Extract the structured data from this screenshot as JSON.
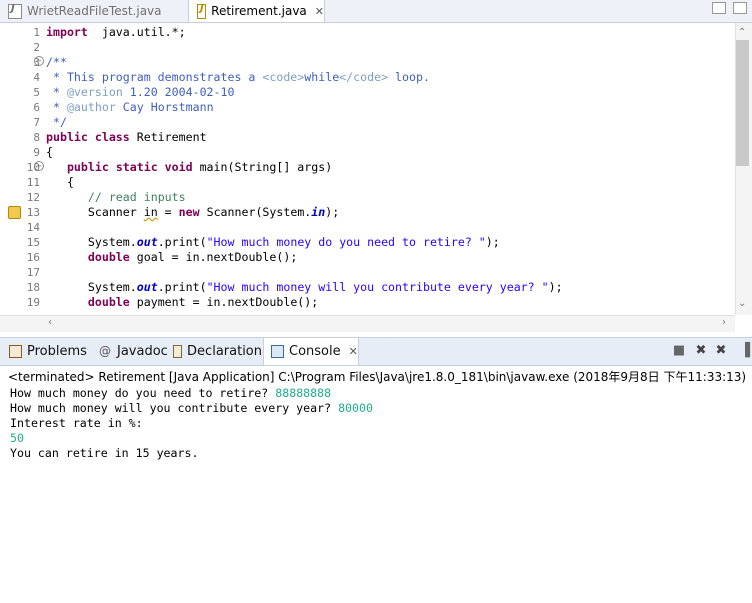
{
  "editor_tabs": [
    {
      "label": "WrietReadFileTest.java",
      "active": false
    },
    {
      "label": "Retirement.java",
      "active": true
    }
  ],
  "editor": {
    "line_numbers": [
      "1",
      "2",
      "3",
      "4",
      "5",
      "6",
      "7",
      "8",
      "9",
      "10",
      "11",
      "12",
      "13",
      "14",
      "15",
      "16",
      "17",
      "18",
      "19"
    ],
    "lines": [
      {
        "n": 1,
        "parts": [
          [
            "kw",
            "import"
          ],
          [
            "",
            "  java.util.*;"
          ]
        ]
      },
      {
        "n": 2,
        "parts": []
      },
      {
        "n": 3,
        "parts": [
          [
            "doc",
            "/**"
          ]
        ]
      },
      {
        "n": 4,
        "parts": [
          [
            "doc",
            " * This program demonstrates a "
          ],
          [
            "tag",
            "<code>"
          ],
          [
            "doc",
            "while"
          ],
          [
            "tag",
            "</code>"
          ],
          [
            "doc",
            " loop."
          ]
        ]
      },
      {
        "n": 5,
        "parts": [
          [
            "doc",
            " * "
          ],
          [
            "tag",
            "@version"
          ],
          [
            "doc",
            " 1.20 2004-02-10"
          ]
        ]
      },
      {
        "n": 6,
        "parts": [
          [
            "doc",
            " * "
          ],
          [
            "tag",
            "@author"
          ],
          [
            "doc",
            " Cay Horstmann"
          ]
        ]
      },
      {
        "n": 7,
        "parts": [
          [
            "doc",
            " */"
          ]
        ]
      },
      {
        "n": 8,
        "parts": [
          [
            "kw",
            "public class"
          ],
          [
            "",
            " Retirement"
          ]
        ]
      },
      {
        "n": 9,
        "parts": [
          [
            "",
            "{"
          ]
        ]
      },
      {
        "n": 10,
        "parts": [
          [
            "",
            "   "
          ],
          [
            "kw",
            "public static void"
          ],
          [
            "",
            " main(String[] args)"
          ]
        ]
      },
      {
        "n": 11,
        "parts": [
          [
            "",
            "   {"
          ]
        ]
      },
      {
        "n": 12,
        "parts": [
          [
            "",
            "      "
          ],
          [
            "cmt",
            "// read inputs"
          ]
        ]
      },
      {
        "n": 13,
        "parts": [
          [
            "",
            "      Scanner "
          ],
          [
            "squig",
            "in"
          ],
          [
            "",
            " = "
          ],
          [
            "kw",
            "new"
          ],
          [
            "",
            " Scanner(System."
          ],
          [
            "field",
            "in"
          ],
          [
            "",
            ");"
          ]
        ]
      },
      {
        "n": 14,
        "parts": []
      },
      {
        "n": 15,
        "parts": [
          [
            "",
            "      System."
          ],
          [
            "field",
            "out"
          ],
          [
            "",
            ".print("
          ],
          [
            "str",
            "\"How much money do you need to retire? \""
          ],
          [
            "",
            ");"
          ]
        ]
      },
      {
        "n": 16,
        "parts": [
          [
            "",
            "      "
          ],
          [
            "kw",
            "double"
          ],
          [
            "",
            " goal = in.nextDouble();"
          ]
        ]
      },
      {
        "n": 17,
        "parts": []
      },
      {
        "n": 18,
        "parts": [
          [
            "",
            "      System."
          ],
          [
            "field",
            "out"
          ],
          [
            "",
            ".print("
          ],
          [
            "str",
            "\"How much money will you contribute every year? \""
          ],
          [
            "",
            ");"
          ]
        ]
      },
      {
        "n": 19,
        "parts": [
          [
            "",
            "      "
          ],
          [
            "kw",
            "double"
          ],
          [
            "",
            " payment = in.nextDouble();"
          ]
        ]
      }
    ]
  },
  "panel_tabs": [
    {
      "label": "Problems",
      "icon": "problems-icon",
      "active": false
    },
    {
      "label": "Javadoc",
      "icon": "at-icon",
      "active": false
    },
    {
      "label": "Declaration",
      "icon": "declaration-icon",
      "active": false
    },
    {
      "label": "Console",
      "icon": "console-icon",
      "active": true
    }
  ],
  "console": {
    "terminated": "<terminated> Retirement [Java Application] C:\\Program Files\\Java\\jre1.8.0_181\\bin\\javaw.exe (2018年9月8日 下午11:33:13)",
    "lines": [
      {
        "text": "How much money do you need to retire? ",
        "input": "88888888"
      },
      {
        "text": "How much money will you contribute every year? ",
        "input": "80000"
      },
      {
        "text": "Interest rate in %:",
        "input": ""
      },
      {
        "text": "",
        "input": "50"
      },
      {
        "text": "You can retire in 15 years.",
        "input": ""
      }
    ]
  },
  "colors": {
    "keyword": "#7f0055",
    "string": "#2a00ff",
    "comment": "#3f7f5f",
    "javadoc": "#3f5fbf",
    "console_input": "#1fae8a"
  }
}
